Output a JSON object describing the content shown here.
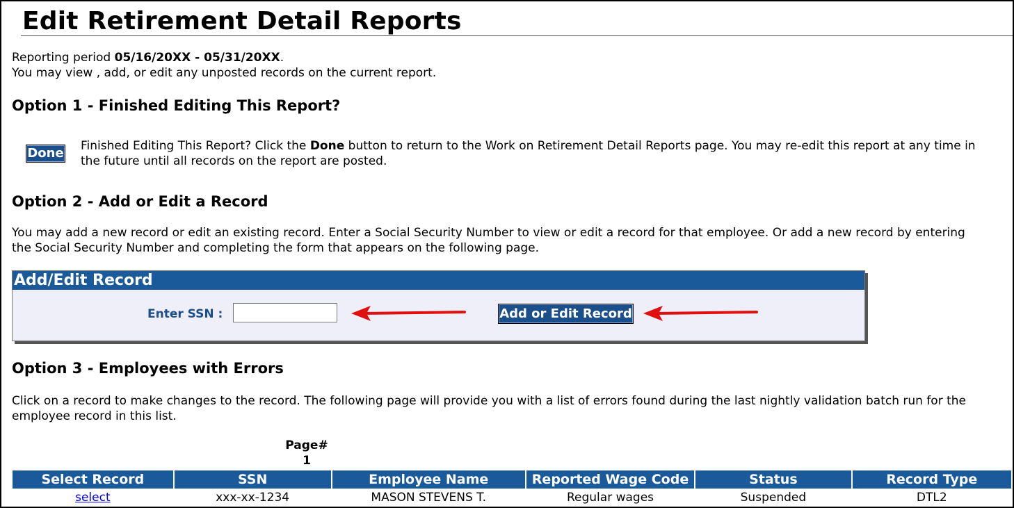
{
  "page": {
    "title": "Edit Retirement Detail Reports",
    "period_prefix": "Reporting period ",
    "period_start": "05/16/20XX",
    "period_sep": " - ",
    "period_end": "05/31/20XX",
    "period_suffix": ".",
    "intro": "You may view , add, or edit any unposted records on the current report."
  },
  "option1": {
    "heading": "Option 1 - Finished Editing This Report?",
    "done_label": "Done",
    "desc_a": "Finished Editing This Report? Click the ",
    "desc_bold": "Done",
    "desc_b": " button to return to the Work on Retirement Detail Reports page. You may re-edit this report at any time in",
    "desc_line2": "the future until all records on the report are posted."
  },
  "option2": {
    "heading": "Option 2 - Add or Edit a Record",
    "desc_line1": "You may add a new record or edit an existing record. Enter a Social Security Number to view or edit a record for that employee. Or add a new record by entering",
    "desc_line2": "the Social Security Number and completing the form that appears on the following page.",
    "panel_title": "Add/Edit Record",
    "ssn_label": "Enter SSN :",
    "ssn_value": "",
    "button_label": "Add or Edit Record",
    "arrow_color": "#e01010"
  },
  "option3": {
    "heading": "Option 3 - Employees with Errors",
    "desc_line1": "Click on a record to make changes to the record. The following page will provide you with a list of errors found during the last nightly validation batch run for the",
    "desc_line2": "employee record in this list.",
    "page_label": "Page#",
    "page_number": "1",
    "columns": [
      "Select Record",
      "SSN",
      "Employee Name",
      "Reported Wage Code",
      "Status",
      "Record Type"
    ],
    "rows": [
      {
        "select": "select",
        "ssn": "xxx-xx-1234",
        "name": "MASON STEVENS T.",
        "wage_code": "Regular wages",
        "status": "Suspended",
        "record_type": "DTL2"
      }
    ]
  },
  "colors": {
    "header_blue": "#1b5a9a",
    "button_blue": "#1b4f8c",
    "panel_bg": "#efeffa"
  }
}
